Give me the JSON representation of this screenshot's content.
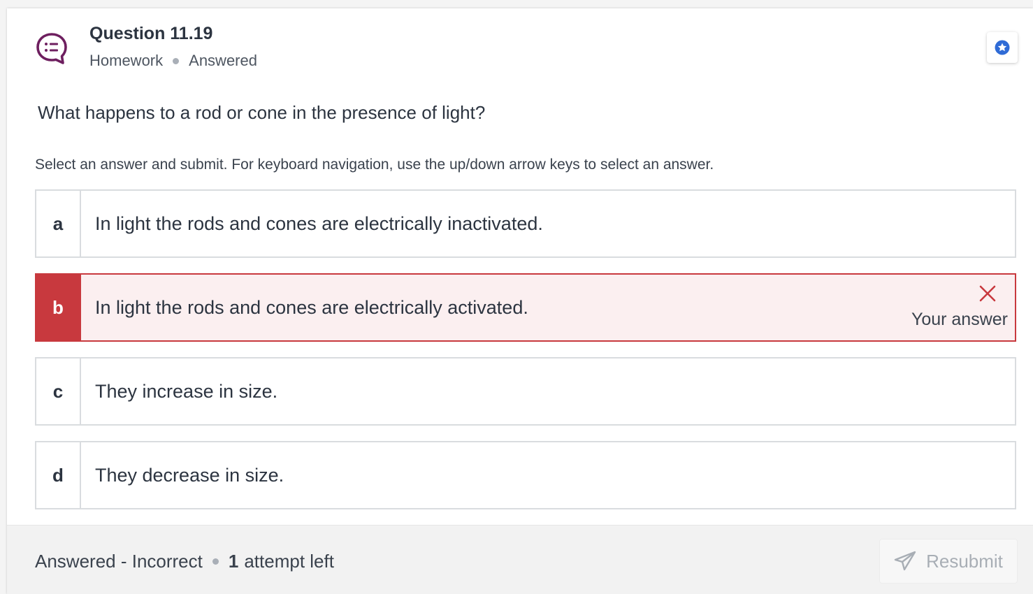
{
  "header": {
    "title": "Question 11.19",
    "category": "Homework",
    "state": "Answered",
    "icon": "question-bubble-icon",
    "bookmark_icon": "star-icon"
  },
  "question": "What happens to a rod or cone in the presence of light?",
  "instructions": "Select an answer and submit. For keyboard navigation, use the up/down arrow keys to select an answer.",
  "choices": [
    {
      "letter": "a",
      "text": "In light the rods and cones are electrically inactivated."
    },
    {
      "letter": "b",
      "text": "In light the rods and cones are electrically activated.",
      "selected": true,
      "correct": false
    },
    {
      "letter": "c",
      "text": "They increase in size."
    },
    {
      "letter": "d",
      "text": "They decrease in size."
    }
  ],
  "feedback": {
    "icon": "close-icon",
    "label": "Your answer"
  },
  "footer": {
    "status": "Answered - Incorrect",
    "attempts_count": "1",
    "attempts_label": "attempt left",
    "resubmit_label": "Resubmit",
    "resubmit_icon": "send-icon"
  },
  "colors": {
    "brand_icon": "#6e1f5f",
    "incorrect": "#c8393e",
    "incorrect_bg": "#fbeff0",
    "bookmark": "#2f6bd6"
  }
}
